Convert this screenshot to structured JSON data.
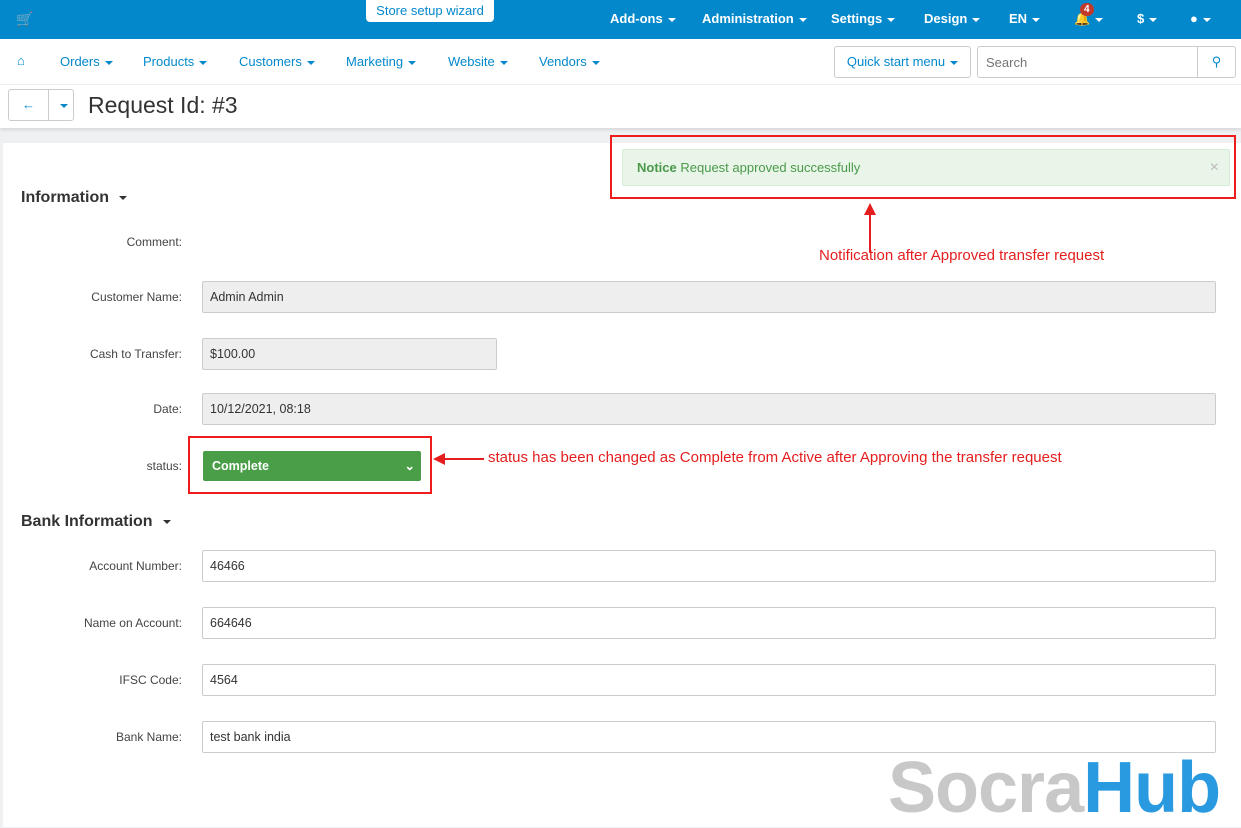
{
  "topbar": {
    "wizard": "Store setup wizard",
    "items": [
      "Add-ons",
      "Administration",
      "Settings",
      "Design",
      "EN"
    ],
    "notification_count": "4",
    "currency": "$"
  },
  "nav": {
    "items": [
      "Orders",
      "Products",
      "Customers",
      "Marketing",
      "Website",
      "Vendors"
    ],
    "quick_start": "Quick start menu",
    "search_placeholder": "Search"
  },
  "page": {
    "title": "Request Id: #3"
  },
  "notice": {
    "title": "Notice",
    "message": "Request approved successfully"
  },
  "information": {
    "heading": "Information",
    "comment_label": "Comment:",
    "customer_label": "Customer Name:",
    "customer": "Admin Admin",
    "cash_label": "Cash to Transfer:",
    "cash": "$100.00",
    "date_label": "Date:",
    "date": "10/12/2021, 08:18",
    "status_label": "status:",
    "status": "Complete"
  },
  "bank": {
    "heading": "Bank Information",
    "account_label": "Account Number:",
    "account": "46466",
    "name_label": "Name on Account:",
    "name": "664646",
    "ifsc_label": "IFSC Code:",
    "ifsc": "4564",
    "bank_label": "Bank Name:",
    "bank": "test bank india"
  },
  "annotations": {
    "notice": "Notification after Approved transfer request",
    "status": "status has been changed as Complete from Active after Approving the transfer request"
  },
  "watermark": {
    "part1": "Socra",
    "part2": "Hub"
  },
  "colors": {
    "primary": "#0388cc",
    "success": "#4a9e48",
    "annotation": "#e41e1e"
  }
}
